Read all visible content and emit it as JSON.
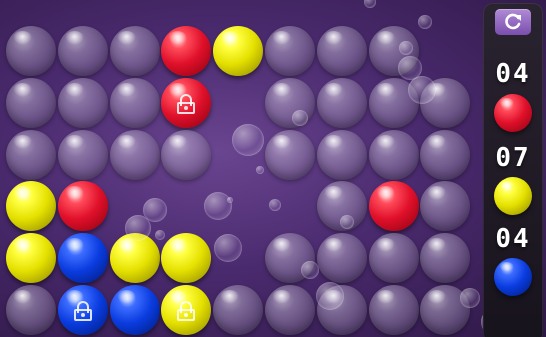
{
  "board": {
    "columns": 9,
    "rows": 6,
    "grid": [
      [
        "empty",
        "empty",
        "empty",
        "red",
        "yellow",
        "empty",
        "empty",
        "empty",
        "empty"
      ],
      [
        "empty",
        "empty",
        "empty",
        "red",
        "empty",
        "empty",
        "empty",
        "empty",
        "empty"
      ],
      [
        "empty",
        "empty",
        "empty",
        "empty",
        "empty",
        "empty",
        "empty",
        "empty",
        "empty"
      ],
      [
        "yellow",
        "red",
        "empty",
        "empty",
        "empty",
        "empty",
        "empty",
        "red",
        "empty"
      ],
      [
        "yellow",
        "blue",
        "yellow",
        "yellow",
        "empty",
        "empty",
        "empty",
        "empty",
        "empty"
      ],
      [
        "empty",
        "blue",
        "blue",
        "yellow",
        "empty",
        "empty",
        "empty",
        "empty",
        "empty"
      ]
    ],
    "locked": [
      [
        1,
        3
      ],
      [
        5,
        1
      ],
      [
        5,
        3
      ]
    ],
    "hidden_cells": [
      [
        0,
        8
      ],
      [
        1,
        4
      ],
      [
        2,
        4
      ],
      [
        3,
        2
      ],
      [
        3,
        3
      ],
      [
        3,
        4
      ],
      [
        3,
        5
      ],
      [
        4,
        4
      ]
    ]
  },
  "sidebar": {
    "restart_icon": "restart-icon",
    "counters": [
      {
        "count": "04",
        "color": "red"
      },
      {
        "count": "07",
        "color": "yellow"
      },
      {
        "count": "04",
        "color": "blue"
      }
    ]
  },
  "colors": {
    "red": "#e0102a",
    "yellow": "#e4e000",
    "blue": "#0a3ce0",
    "background": "#4a2a6e",
    "button": "#9b6fc6"
  }
}
